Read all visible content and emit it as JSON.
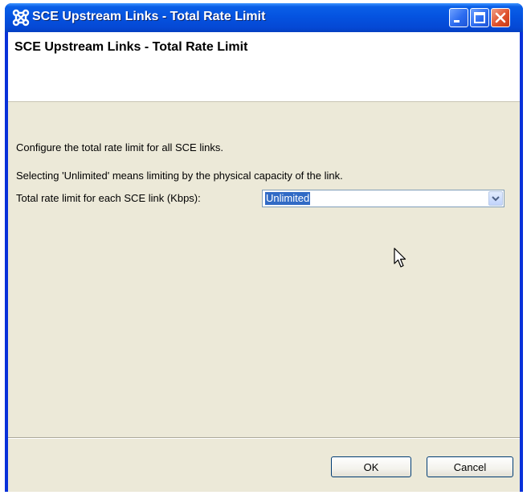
{
  "window": {
    "title": "SCE Upstream Links - Total Rate Limit"
  },
  "banner": {
    "title": "SCE Upstream Links - Total Rate Limit"
  },
  "content": {
    "description": "Configure the total rate limit for all SCE links.",
    "note": "Selecting 'Unlimited' means limiting by the physical capacity of the link.",
    "field_label": "Total rate limit for each SCE link (Kbps):",
    "field_value": "Unlimited"
  },
  "buttons": {
    "ok": "OK",
    "cancel": "Cancel"
  },
  "colors": {
    "titlebar": "#0553e0",
    "dialog_bg": "#ece9d8",
    "selection": "#316ac5"
  },
  "icons": [
    "app-icon",
    "minimize-icon",
    "maximize-icon",
    "close-icon",
    "dropdown-arrow-icon",
    "mouse-cursor-icon"
  ]
}
